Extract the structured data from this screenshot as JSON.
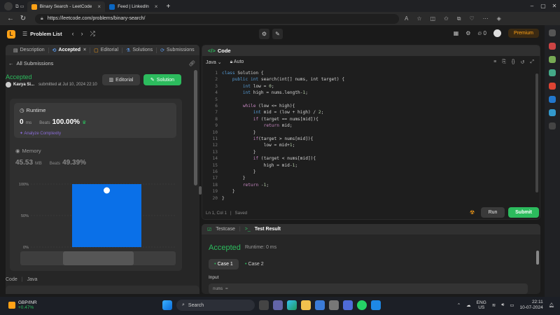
{
  "browser": {
    "tabs": [
      {
        "label": "Binary Search - LeetCode",
        "active": true
      },
      {
        "label": "Feed | LinkedIn",
        "active": false
      }
    ],
    "new_tab": "+",
    "url": "https://leetcode.com/problems/binary-search/"
  },
  "header": {
    "logo": "L",
    "problem_list": "Problem List",
    "fire_count": "0",
    "premium": "Premium"
  },
  "left_tabs": [
    {
      "label": "Description",
      "icon": "≡"
    },
    {
      "label": "Accepted",
      "icon": "⟲"
    },
    {
      "label": "Editorial",
      "icon": "▢"
    },
    {
      "label": "Solutions",
      "icon": "⚗"
    },
    {
      "label": "Submissions",
      "icon": "⟳"
    }
  ],
  "submission": {
    "back_label": "All Submissions",
    "status": "Accepted",
    "user": "Kavya Si...",
    "submitted": "submitted at Jul 10, 2024 22:10",
    "editorial_btn": "Editorial",
    "solution_btn": "Solution",
    "runtime_title": "Runtime",
    "runtime_value": "0",
    "runtime_unit": "ms",
    "runtime_beats_label": "Beats",
    "runtime_beats": "100.00%",
    "analyze": "Analyze Complexity",
    "memory_title": "Memory",
    "memory_value": "45.53",
    "memory_unit": "MB",
    "memory_beats_label": "Beats",
    "memory_beats": "49.39%",
    "code_label": "Code",
    "code_lang": "Java"
  },
  "chart_data": {
    "type": "bar",
    "categories": [
      "0ms"
    ],
    "values": [
      100
    ],
    "ylim": [
      0,
      100
    ],
    "yticks": [
      "0%",
      "50%",
      "100%"
    ],
    "bar_color": "#0a70e8",
    "grid": true
  },
  "code_panel": {
    "title": "Code",
    "language": "Java",
    "mode": "Auto",
    "cursor": "Ln 1, Col 1",
    "saved": "Saved",
    "run": "Run",
    "submit": "Submit",
    "lines": [
      [
        {
          "t": "kw",
          "v": "class "
        },
        {
          "t": "pl",
          "v": "Solution {"
        }
      ],
      [
        {
          "t": "pl",
          "v": "    "
        },
        {
          "t": "kw",
          "v": "public int "
        },
        {
          "t": "pl",
          "v": "search(int[] nums, int target) {"
        }
      ],
      [
        {
          "t": "pl",
          "v": "        "
        },
        {
          "t": "kw",
          "v": "int "
        },
        {
          "t": "pl",
          "v": "low = "
        },
        {
          "t": "nm",
          "v": "0"
        },
        {
          "t": "pl",
          "v": ";"
        }
      ],
      [
        {
          "t": "pl",
          "v": "        "
        },
        {
          "t": "kw",
          "v": "int "
        },
        {
          "t": "pl",
          "v": "high = nums.length-"
        },
        {
          "t": "nm",
          "v": "1"
        },
        {
          "t": "pl",
          "v": ";"
        }
      ],
      [
        {
          "t": "pl",
          "v": ""
        }
      ],
      [
        {
          "t": "pl",
          "v": "        "
        },
        {
          "t": "st",
          "v": "while "
        },
        {
          "t": "pl",
          "v": "(low <= high){"
        }
      ],
      [
        {
          "t": "pl",
          "v": "            "
        },
        {
          "t": "kw",
          "v": "int "
        },
        {
          "t": "pl",
          "v": "mid = (low + high) / "
        },
        {
          "t": "nm",
          "v": "2"
        },
        {
          "t": "pl",
          "v": ";"
        }
      ],
      [
        {
          "t": "pl",
          "v": "            "
        },
        {
          "t": "st",
          "v": "if "
        },
        {
          "t": "pl",
          "v": "(target == nums[mid]){"
        }
      ],
      [
        {
          "t": "pl",
          "v": "                "
        },
        {
          "t": "st",
          "v": "return "
        },
        {
          "t": "pl",
          "v": "mid;"
        }
      ],
      [
        {
          "t": "pl",
          "v": "            }"
        }
      ],
      [
        {
          "t": "pl",
          "v": "            "
        },
        {
          "t": "st",
          "v": "if"
        },
        {
          "t": "pl",
          "v": "(target > nums[mid]){"
        }
      ],
      [
        {
          "t": "pl",
          "v": "                low = mid+"
        },
        {
          "t": "nm",
          "v": "1"
        },
        {
          "t": "pl",
          "v": ";"
        }
      ],
      [
        {
          "t": "pl",
          "v": "            }"
        }
      ],
      [
        {
          "t": "pl",
          "v": "            "
        },
        {
          "t": "st",
          "v": "if "
        },
        {
          "t": "pl",
          "v": "(target < nums[mid]){"
        }
      ],
      [
        {
          "t": "pl",
          "v": "                high = mid-"
        },
        {
          "t": "nm",
          "v": "1"
        },
        {
          "t": "pl",
          "v": ";"
        }
      ],
      [
        {
          "t": "pl",
          "v": "            }"
        }
      ],
      [
        {
          "t": "pl",
          "v": "        }"
        }
      ],
      [
        {
          "t": "pl",
          "v": "        "
        },
        {
          "t": "st",
          "v": "return "
        },
        {
          "t": "pl",
          "v": "-"
        },
        {
          "t": "nm",
          "v": "1"
        },
        {
          "t": "pl",
          "v": ";"
        }
      ],
      [
        {
          "t": "pl",
          "v": "    }"
        }
      ],
      [
        {
          "t": "pl",
          "v": "}"
        }
      ]
    ]
  },
  "test_panel": {
    "testcase_tab": "Testcase",
    "result_tab": "Test Result",
    "status": "Accepted",
    "runtime": "Runtime: 0 ms",
    "case1": "Case 1",
    "case2": "Case 2",
    "input_label": "Input",
    "input_value": "nums ="
  },
  "taskbar": {
    "ticker": "GBP/INR",
    "ticker_change": "+0.47%",
    "search": "Search",
    "lang_top": "ENG",
    "lang_bottom": "US",
    "time": "22:11",
    "date": "10-07-2024"
  },
  "colors": {
    "accent_green": "#2cbb5d",
    "accent_orange": "#ffa116",
    "chart_blue": "#0a70e8"
  }
}
